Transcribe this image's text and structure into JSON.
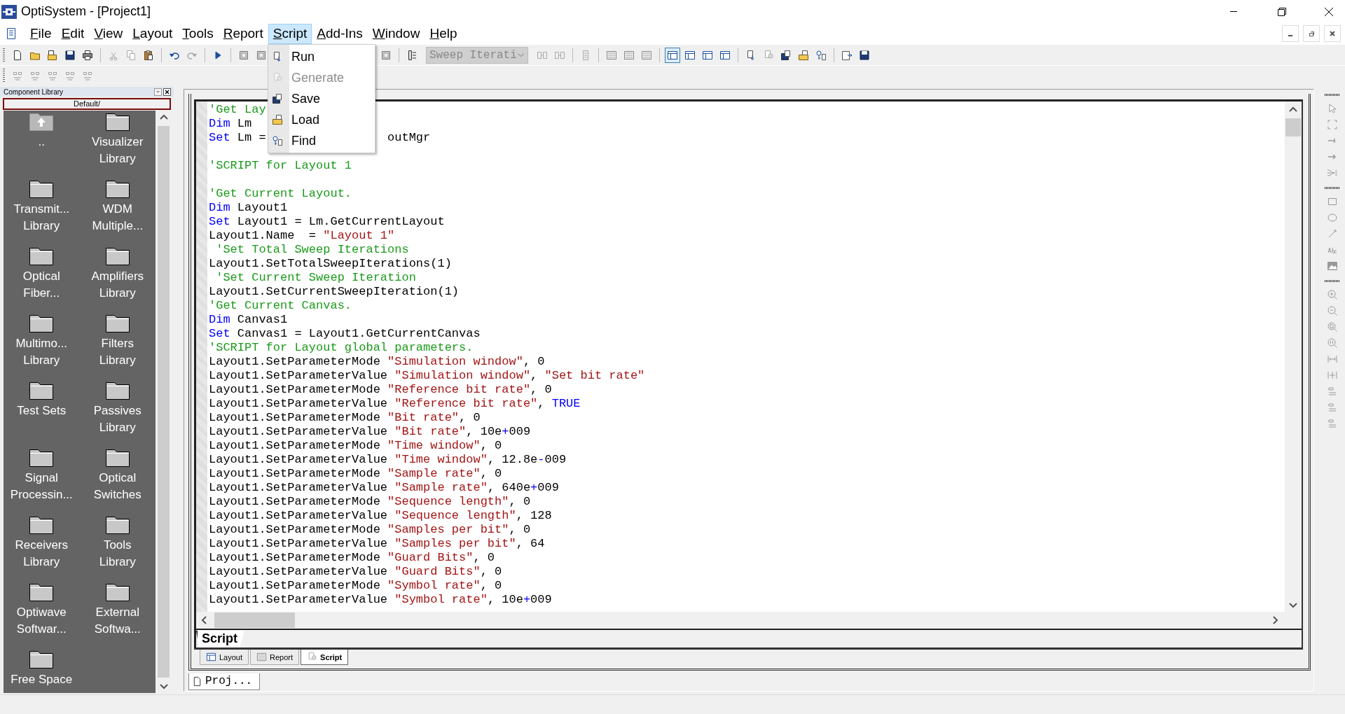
{
  "window": {
    "title": "OptiSystem - [Project1]"
  },
  "menu": [
    {
      "label": "File",
      "selected": false
    },
    {
      "label": "Edit",
      "selected": false
    },
    {
      "label": "View",
      "selected": false
    },
    {
      "label": "Layout",
      "selected": false
    },
    {
      "label": "Tools",
      "selected": false
    },
    {
      "label": "Report",
      "selected": false
    },
    {
      "label": "Script",
      "selected": true
    },
    {
      "label": "Add-Ins",
      "selected": false
    },
    {
      "label": "Window",
      "selected": false
    },
    {
      "label": "Help",
      "selected": false
    }
  ],
  "script_menu": [
    {
      "label": "Run",
      "disabled": false
    },
    {
      "label": "Generate",
      "disabled": true
    },
    {
      "label": "Save",
      "disabled": false
    },
    {
      "label": "Load",
      "disabled": false
    },
    {
      "label": "Find",
      "disabled": false
    }
  ],
  "sweep_combo": {
    "value": "Sweep Iterati",
    "disabled": true
  },
  "component_library": {
    "title": "Component Library",
    "path": "Default/",
    "items": [
      {
        "kind": "up",
        "label": ".."
      },
      {
        "kind": "folder",
        "label": "Visualizer\nLibrary"
      },
      {
        "kind": "folder",
        "label": "Transmit...\nLibrary"
      },
      {
        "kind": "folder",
        "label": "WDM\nMultiple..."
      },
      {
        "kind": "folder",
        "label": "Optical\nFiber..."
      },
      {
        "kind": "folder",
        "label": "Amplifiers\nLibrary"
      },
      {
        "kind": "folder",
        "label": "Multimo...\nLibrary"
      },
      {
        "kind": "folder",
        "label": "Filters\nLibrary"
      },
      {
        "kind": "folder",
        "label": "Test Sets"
      },
      {
        "kind": "folder",
        "label": "Passives\nLibrary"
      },
      {
        "kind": "folder",
        "label": "Signal\nProcessin..."
      },
      {
        "kind": "folder",
        "label": "Optical\nSwitches"
      },
      {
        "kind": "folder",
        "label": "Receivers\nLibrary"
      },
      {
        "kind": "folder",
        "label": "Tools\nLibrary"
      },
      {
        "kind": "folder",
        "label": "Optiwave\nSoftwar..."
      },
      {
        "kind": "folder",
        "label": "External\nSoftwa..."
      },
      {
        "kind": "folder",
        "label": "Free Space"
      }
    ]
  },
  "editor": {
    "lines": [
      {
        "kind": "code",
        "segments": [
          {
            "kind": "comment",
            "text": "'Get Lay"
          }
        ]
      },
      {
        "kind": "code",
        "segments": [
          {
            "kind": "keyword",
            "text": "Dim"
          },
          {
            "kind": "plain",
            "text": " Lm"
          }
        ]
      },
      {
        "kind": "code",
        "segments": [
          {
            "kind": "keyword",
            "text": "Set"
          },
          {
            "kind": "plain",
            "text": " Lm ="
          },
          {
            "kind": "covered"
          },
          {
            "kind": "plain",
            "text": "outMgr"
          }
        ]
      },
      {
        "kind": "blank"
      },
      {
        "kind": "code",
        "segments": [
          {
            "kind": "comment",
            "text": "'SCRIPT for Layout 1"
          }
        ]
      },
      {
        "kind": "blank"
      },
      {
        "kind": "code",
        "segments": [
          {
            "kind": "comment",
            "text": "'Get Current Layout."
          }
        ]
      },
      {
        "kind": "code",
        "segments": [
          {
            "kind": "keyword",
            "text": "Dim"
          },
          {
            "kind": "plain",
            "text": " Layout1"
          }
        ]
      },
      {
        "kind": "code",
        "segments": [
          {
            "kind": "keyword",
            "text": "Set"
          },
          {
            "kind": "plain",
            "text": " Layout1 = Lm.GetCurrentLayout"
          }
        ]
      },
      {
        "kind": "code",
        "segments": [
          {
            "kind": "plain",
            "text": "Layout1.Name  = "
          },
          {
            "kind": "string",
            "text": "\"Layout 1\""
          }
        ]
      },
      {
        "kind": "code",
        "segments": [
          {
            "kind": "comment",
            "text": " 'Set Total Sweep Iterations"
          }
        ]
      },
      {
        "kind": "code",
        "segments": [
          {
            "kind": "plain",
            "text": "Layout1.SetTotalSweepIterations(1)"
          }
        ]
      },
      {
        "kind": "code",
        "segments": [
          {
            "kind": "comment",
            "text": " 'Set Current Sweep Iteration"
          }
        ]
      },
      {
        "kind": "code",
        "segments": [
          {
            "kind": "plain",
            "text": "Layout1.SetCurrentSweepIteration(1)"
          }
        ]
      },
      {
        "kind": "code",
        "segments": [
          {
            "kind": "comment",
            "text": "'Get Current Canvas."
          }
        ]
      },
      {
        "kind": "code",
        "segments": [
          {
            "kind": "keyword",
            "text": "Dim"
          },
          {
            "kind": "plain",
            "text": " Canvas1"
          }
        ]
      },
      {
        "kind": "code",
        "segments": [
          {
            "kind": "keyword",
            "text": "Set"
          },
          {
            "kind": "plain",
            "text": " Canvas1 = Layout1.GetCurrentCanvas"
          }
        ]
      },
      {
        "kind": "code",
        "segments": [
          {
            "kind": "comment",
            "text": "'SCRIPT for Layout global parameters."
          }
        ]
      },
      {
        "kind": "code",
        "segments": [
          {
            "kind": "plain",
            "text": "Layout1.SetParameterMode "
          },
          {
            "kind": "string",
            "text": "\"Simulation window\""
          },
          {
            "kind": "plain",
            "text": ", 0"
          }
        ]
      },
      {
        "kind": "code",
        "segments": [
          {
            "kind": "plain",
            "text": "Layout1.SetParameterValue "
          },
          {
            "kind": "string",
            "text": "\"Simulation window\""
          },
          {
            "kind": "plain",
            "text": ", "
          },
          {
            "kind": "string",
            "text": "\"Set bit rate\""
          }
        ]
      },
      {
        "kind": "code",
        "segments": [
          {
            "kind": "plain",
            "text": "Layout1.SetParameterMode "
          },
          {
            "kind": "string",
            "text": "\"Reference bit rate\""
          },
          {
            "kind": "plain",
            "text": ", 0"
          }
        ]
      },
      {
        "kind": "code",
        "segments": [
          {
            "kind": "plain",
            "text": "Layout1.SetParameterValue "
          },
          {
            "kind": "string",
            "text": "\"Reference bit rate\""
          },
          {
            "kind": "plain",
            "text": ", "
          },
          {
            "kind": "keyword",
            "text": "TRUE"
          }
        ]
      },
      {
        "kind": "code",
        "segments": [
          {
            "kind": "plain",
            "text": "Layout1.SetParameterMode "
          },
          {
            "kind": "string",
            "text": "\"Bit rate\""
          },
          {
            "kind": "plain",
            "text": ", 0"
          }
        ]
      },
      {
        "kind": "code",
        "segments": [
          {
            "kind": "plain",
            "text": "Layout1.SetParameterValue "
          },
          {
            "kind": "string",
            "text": "\"Bit rate\""
          },
          {
            "kind": "plain",
            "text": ", 10e"
          },
          {
            "kind": "operator",
            "text": "+"
          },
          {
            "kind": "plain",
            "text": "009"
          }
        ]
      },
      {
        "kind": "code",
        "segments": [
          {
            "kind": "plain",
            "text": "Layout1.SetParameterMode "
          },
          {
            "kind": "string",
            "text": "\"Time window\""
          },
          {
            "kind": "plain",
            "text": ", 0"
          }
        ]
      },
      {
        "kind": "code",
        "segments": [
          {
            "kind": "plain",
            "text": "Layout1.SetParameterValue "
          },
          {
            "kind": "string",
            "text": "\"Time window\""
          },
          {
            "kind": "plain",
            "text": ", 12.8e"
          },
          {
            "kind": "operator",
            "text": "-"
          },
          {
            "kind": "plain",
            "text": "009"
          }
        ]
      },
      {
        "kind": "code",
        "segments": [
          {
            "kind": "plain",
            "text": "Layout1.SetParameterMode "
          },
          {
            "kind": "string",
            "text": "\"Sample rate\""
          },
          {
            "kind": "plain",
            "text": ", 0"
          }
        ]
      },
      {
        "kind": "code",
        "segments": [
          {
            "kind": "plain",
            "text": "Layout1.SetParameterValue "
          },
          {
            "kind": "string",
            "text": "\"Sample rate\""
          },
          {
            "kind": "plain",
            "text": ", 640e"
          },
          {
            "kind": "operator",
            "text": "+"
          },
          {
            "kind": "plain",
            "text": "009"
          }
        ]
      },
      {
        "kind": "code",
        "segments": [
          {
            "kind": "plain",
            "text": "Layout1.SetParameterMode "
          },
          {
            "kind": "string",
            "text": "\"Sequence length\""
          },
          {
            "kind": "plain",
            "text": ", 0"
          }
        ]
      },
      {
        "kind": "code",
        "segments": [
          {
            "kind": "plain",
            "text": "Layout1.SetParameterValue "
          },
          {
            "kind": "string",
            "text": "\"Sequence length\""
          },
          {
            "kind": "plain",
            "text": ", 128"
          }
        ]
      },
      {
        "kind": "code",
        "segments": [
          {
            "kind": "plain",
            "text": "Layout1.SetParameterMode "
          },
          {
            "kind": "string",
            "text": "\"Samples per bit\""
          },
          {
            "kind": "plain",
            "text": ", 0"
          }
        ]
      },
      {
        "kind": "code",
        "segments": [
          {
            "kind": "plain",
            "text": "Layout1.SetParameterValue "
          },
          {
            "kind": "string",
            "text": "\"Samples per bit\""
          },
          {
            "kind": "plain",
            "text": ", 64"
          }
        ]
      },
      {
        "kind": "code",
        "segments": [
          {
            "kind": "plain",
            "text": "Layout1.SetParameterMode "
          },
          {
            "kind": "string",
            "text": "\"Guard Bits\""
          },
          {
            "kind": "plain",
            "text": ", 0"
          }
        ]
      },
      {
        "kind": "code",
        "segments": [
          {
            "kind": "plain",
            "text": "Layout1.SetParameterValue "
          },
          {
            "kind": "string",
            "text": "\"Guard Bits\""
          },
          {
            "kind": "plain",
            "text": ", 0"
          }
        ]
      },
      {
        "kind": "code",
        "segments": [
          {
            "kind": "plain",
            "text": "Layout1.SetParameterMode "
          },
          {
            "kind": "string",
            "text": "\"Symbol rate\""
          },
          {
            "kind": "plain",
            "text": ", 0"
          }
        ]
      },
      {
        "kind": "code",
        "segments": [
          {
            "kind": "plain",
            "text": "Layout1.SetParameterValue "
          },
          {
            "kind": "string",
            "text": "\"Symbol rate\""
          },
          {
            "kind": "plain",
            "text": ", 10e"
          },
          {
            "kind": "operator",
            "text": "+"
          },
          {
            "kind": "plain",
            "text": "009"
          }
        ]
      }
    ],
    "tabs": [
      {
        "label": "Script",
        "selected": true
      }
    ]
  },
  "view_tabs": [
    {
      "kind": "layout",
      "label": "Layout",
      "selected": false
    },
    {
      "kind": "report",
      "label": "Report",
      "selected": false
    },
    {
      "kind": "script",
      "label": "Script",
      "selected": true
    }
  ],
  "project_tabs": [
    {
      "label": "Proj...",
      "selected": true
    }
  ]
}
